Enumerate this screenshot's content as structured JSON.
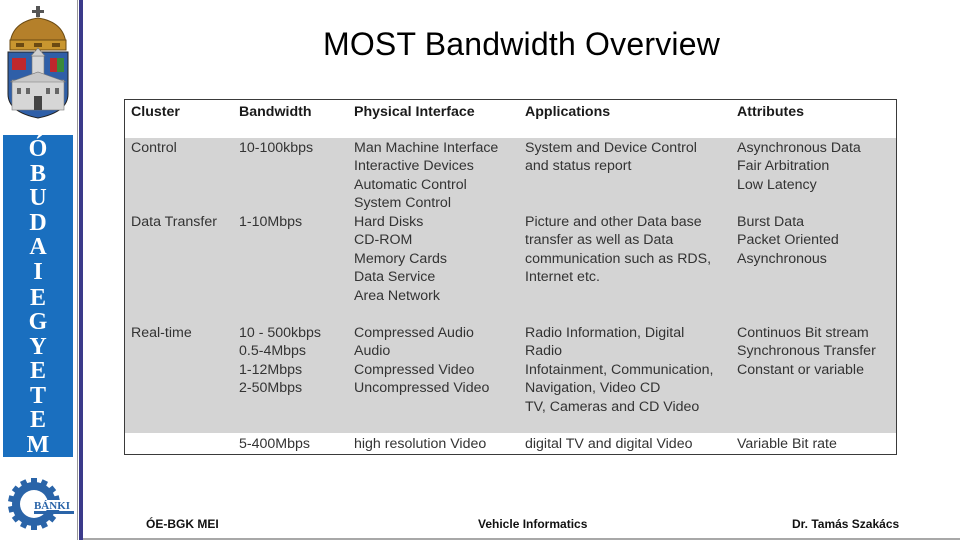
{
  "slide": {
    "title": "MOST Bandwidth Overview"
  },
  "sidebar": {
    "crest_icon": "university-crest-icon",
    "university_letters": [
      "Ó",
      "B",
      "U",
      "D",
      "A",
      "I",
      "",
      "E",
      "G",
      "Y",
      "E",
      "T",
      "E",
      "M"
    ],
    "university_name": "ÓBUDAI EGYETEM",
    "banki_logo_text": "BÁNKI",
    "colors": {
      "band": "#1a6fbf",
      "divider": "#3b3a8a"
    }
  },
  "table": {
    "headers": [
      "Cluster",
      "Bandwidth",
      "Physical Interface",
      "Applications",
      "Attributes"
    ],
    "rows": [
      {
        "cluster": [
          "Control"
        ],
        "bandwidth": [
          "10-100kbps"
        ],
        "physical_interface": [
          "Man Machine Interface",
          "Interactive Devices",
          "Automatic Control",
          "System Control"
        ],
        "applications": [
          "System and Device Control",
          "and status report"
        ],
        "attributes": [
          "Asynchronous Data",
          "Fair Arbitration",
          "Low Latency"
        ]
      },
      {
        "cluster": [
          "Data Transfer"
        ],
        "bandwidth": [
          "1-10Mbps"
        ],
        "physical_interface": [
          "Hard Disks",
          "CD-ROM",
          "Memory Cards",
          "Data Service",
          "Area Network"
        ],
        "applications": [
          "Picture and other Data base",
          "transfer as well as Data",
          "communication such as RDS,",
          "Internet etc."
        ],
        "attributes": [
          "Burst Data",
          "Packet Oriented",
          "Asynchronous"
        ]
      },
      {
        "cluster": [
          "Real-time"
        ],
        "bandwidth": [
          "10 - 500kbps",
          "0.5-4Mbps",
          "1-12Mbps",
          "2-50Mbps"
        ],
        "physical_interface": [
          "Compressed Audio",
          "Audio",
          "Compressed Video",
          "Uncompressed Video"
        ],
        "applications": [
          "Radio Information, Digital",
          "Radio",
          "Infotainment, Communication,",
          "Navigation, Video CD",
          "TV, Cameras and CD Video"
        ],
        "attributes": [
          "Continuos Bit stream",
          "Synchronous Transfer",
          "Constant or variable"
        ]
      },
      {
        "cluster": [
          ""
        ],
        "bandwidth": [
          "5-400Mbps"
        ],
        "physical_interface": [
          "high resolution Video"
        ],
        "applications": [
          "digital TV and digital Video"
        ],
        "attributes": [
          "Variable Bit rate"
        ]
      }
    ],
    "colors": {
      "body_bg": "#d4d4d4",
      "header_bg": "#ffffff",
      "border": "#3a3a3a"
    }
  },
  "footer": {
    "left": "ÓE-BGK MEI",
    "center": "Vehicle Informatics",
    "right": "Dr. Tamás Szakács"
  }
}
